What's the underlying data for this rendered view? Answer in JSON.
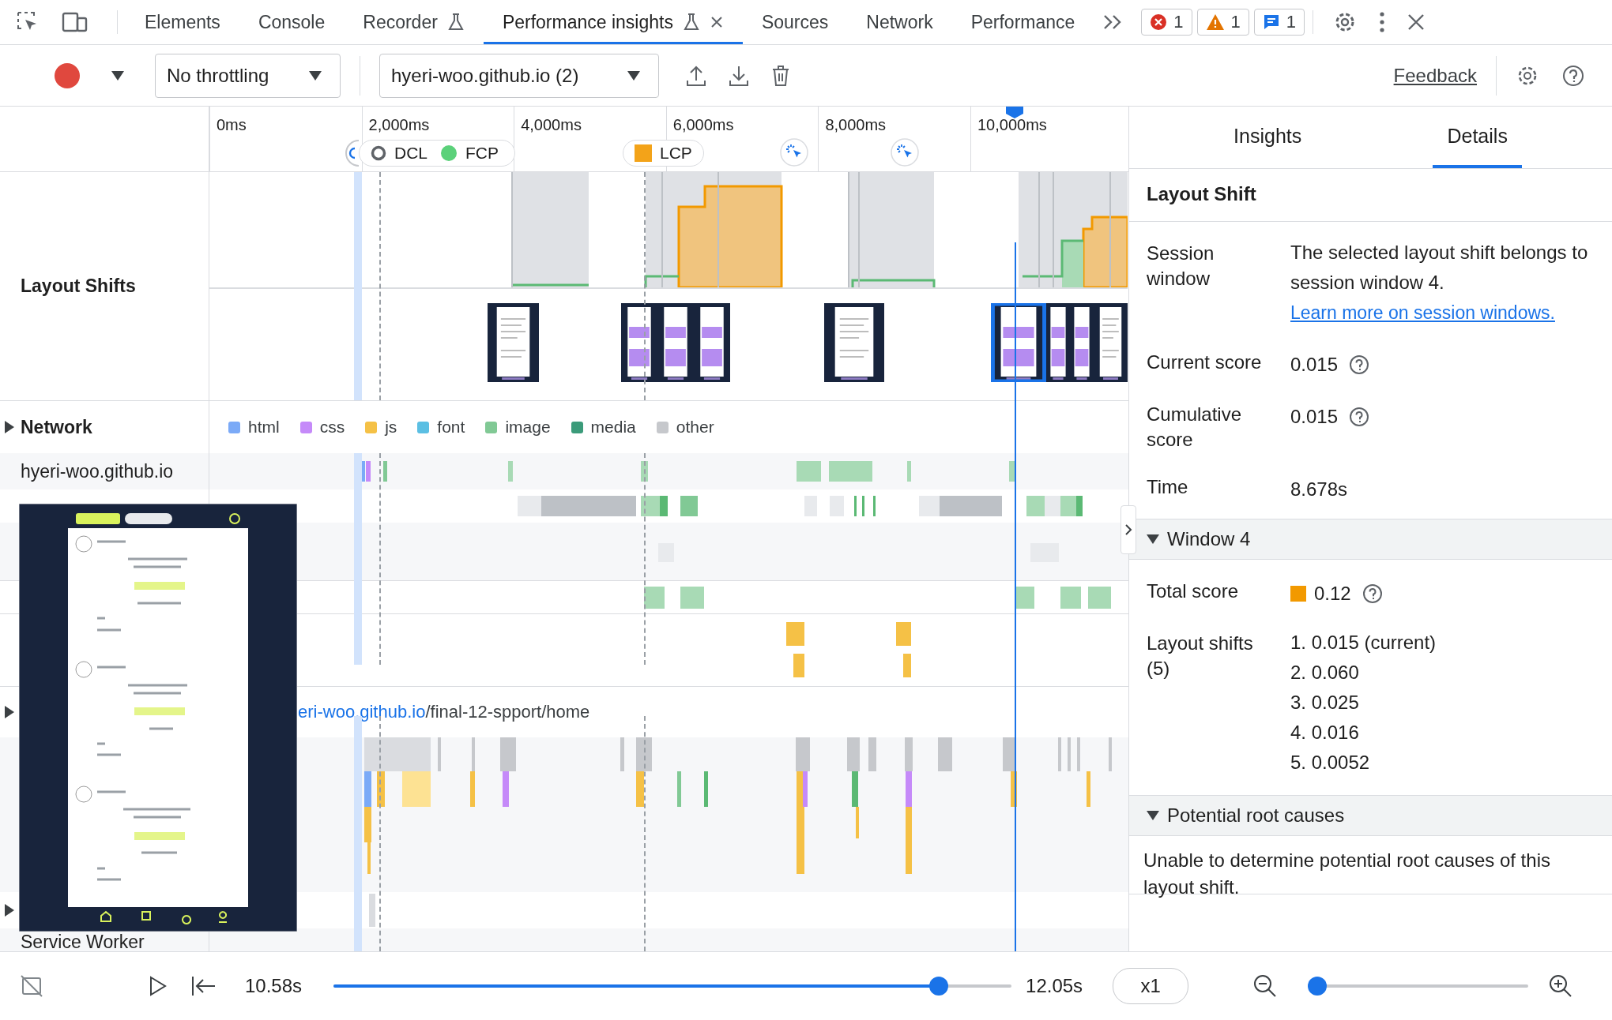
{
  "devtools_tabs": [
    {
      "label": "Elements",
      "selected": false,
      "experimental": false,
      "closable": false
    },
    {
      "label": "Console",
      "selected": false,
      "experimental": false,
      "closable": false
    },
    {
      "label": "Recorder",
      "selected": false,
      "experimental": true,
      "closable": false
    },
    {
      "label": "Performance insights",
      "selected": true,
      "experimental": true,
      "closable": true
    },
    {
      "label": "Sources",
      "selected": false,
      "experimental": false,
      "closable": false
    },
    {
      "label": "Network",
      "selected": false,
      "experimental": false,
      "closable": false
    },
    {
      "label": "Performance",
      "selected": false,
      "experimental": false,
      "closable": false
    }
  ],
  "issue_counts": [
    {
      "kind": "error",
      "count": "1"
    },
    {
      "kind": "warning",
      "count": "1"
    },
    {
      "kind": "info",
      "count": "1"
    }
  ],
  "toolbar": {
    "throttling": "No throttling",
    "recording": "hyeri-woo.github.io (2)",
    "feedback": "Feedback"
  },
  "ruler": {
    "ticks": [
      "0ms",
      "2,000ms",
      "4,000ms",
      "6,000ms",
      "8,000ms",
      "10,000ms"
    ],
    "milestones": [
      {
        "kind": "dcl",
        "label": "DCL"
      },
      {
        "kind": "fcp",
        "label": "FCP"
      },
      {
        "kind": "lcp",
        "label": "LCP"
      }
    ]
  },
  "tracks": {
    "layout_shifts": "Layout Shifts",
    "network": "Network",
    "legend": [
      {
        "label": "html",
        "color": "#7baaf7"
      },
      {
        "label": "css",
        "color": "#c58af9"
      },
      {
        "label": "js",
        "color": "#f5c146"
      },
      {
        "label": "font",
        "color": "#5bbfe3"
      },
      {
        "label": "image",
        "color": "#81c995"
      },
      {
        "label": "media",
        "color": "#3b9b7a"
      },
      {
        "label": "other",
        "color": "#c6c8cc"
      }
    ],
    "network_rows": [
      "hyeri-woo.github.io"
    ],
    "page_link": {
      "host": "eri-woo.github.io",
      "path": "/final-12-spport/home"
    },
    "service_worker": "Service Worker"
  },
  "details_panel": {
    "tabs": [
      {
        "label": "Insights",
        "selected": false
      },
      {
        "label": "Details",
        "selected": true
      }
    ],
    "title": "Layout Shift",
    "session": {
      "label": "Session window",
      "text": "The selected layout shift belongs to session window 4.",
      "link": "Learn more on session windows."
    },
    "rows": [
      {
        "label": "Current score",
        "value": "0.015",
        "help": true
      },
      {
        "label": "Cumulative score",
        "value": "0.015",
        "help": true
      },
      {
        "label": "Time",
        "value": "8.678s",
        "help": false
      }
    ],
    "window": {
      "title": "Window 4",
      "expanded": true,
      "total_label": "Total score",
      "total": "0.12",
      "shifts_label": "Layout shifts (5)",
      "shifts": [
        "1. 0.015 (current)",
        "2. 0.060",
        "3. 0.025",
        "4. 0.016",
        "5. 0.0052"
      ]
    },
    "root_causes": {
      "title": "Potential root causes",
      "expanded": true,
      "text": "Unable to determine potential root causes of this layout shift."
    }
  },
  "playback": {
    "start": "10.58s",
    "progress": {
      "level": 0.868
    },
    "end": "12.05s",
    "speed": "x1",
    "zoom": {
      "level": 0.03
    }
  }
}
